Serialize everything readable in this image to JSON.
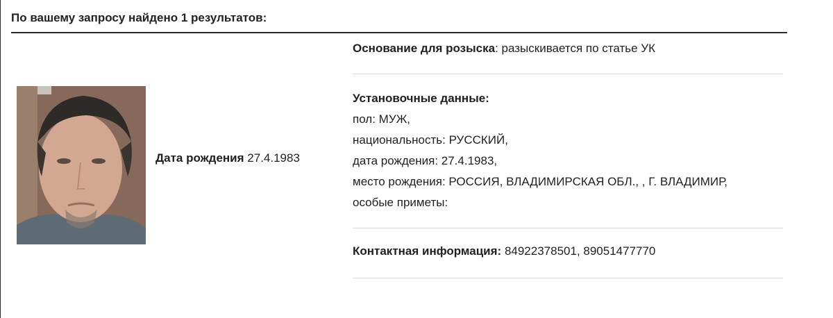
{
  "header": {
    "title": "По вашему запросу найдено 1 результатов:"
  },
  "person": {
    "dob_label": "Дата рождения",
    "dob_value": "27.4.1983"
  },
  "details": {
    "basis_label": "Основание для розыска",
    "basis_value": ": разыскивается по статье УК",
    "ident_label": "Установочные данные:",
    "ident_lines": [
      "пол: МУЖ,",
      "национальность: РУССКИЙ,",
      "дата рождения: 27.4.1983,",
      "место рождения: РОССИЯ, ВЛАДИМИРСКАЯ ОБЛ., , Г. ВЛАДИМИР,",
      "особые приметы:"
    ],
    "contact_label": "Контактная информация:",
    "contact_value": " 84922378501, 89051477770"
  }
}
